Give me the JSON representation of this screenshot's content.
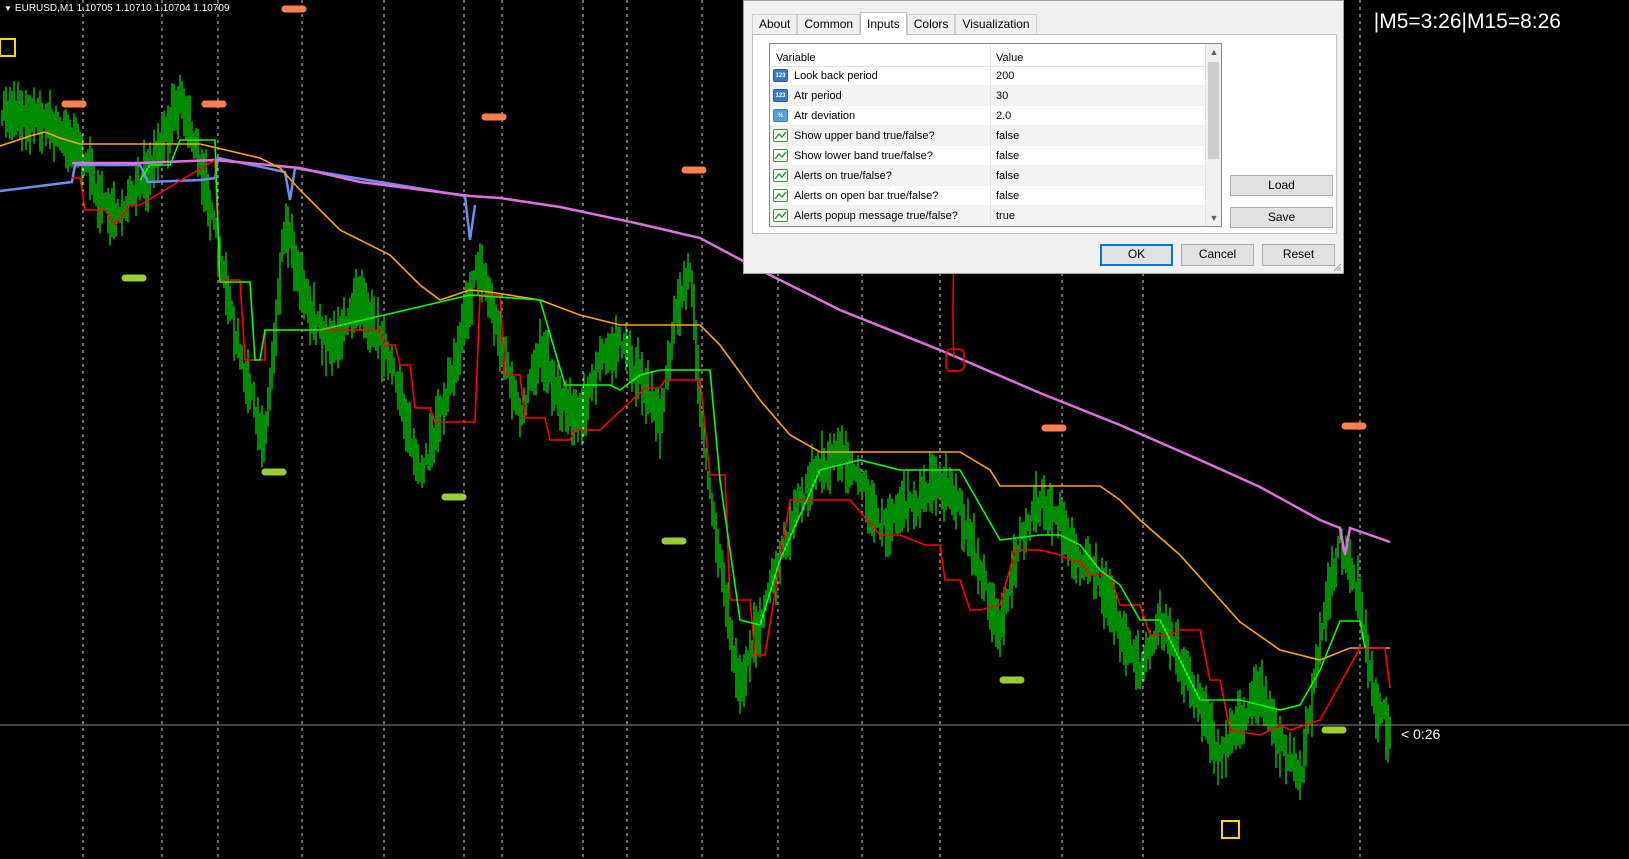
{
  "chart": {
    "symbol_info": "EURUSD,M1  1.10705 1.10710 1.10704 1.10709",
    "timer_text": "|M5=3:26|M15=8:26",
    "price_marker": "< 0:26"
  },
  "colors": {
    "background": "#000000",
    "candles": "#00ff00",
    "ma_magenta": "#e070e0",
    "ma_orange": "#ffa500",
    "step_red": "#ff0000",
    "step_green": "#00ff00",
    "upper_dash": "#ff7f50",
    "lower_dash": "#9acd32",
    "annotation": "#ff0000",
    "box_marker": "#ffd700"
  },
  "dialog": {
    "tabs": [
      {
        "label": "About",
        "active": false
      },
      {
        "label": "Common",
        "active": false
      },
      {
        "label": "Inputs",
        "active": true
      },
      {
        "label": "Colors",
        "active": false
      },
      {
        "label": "Visualization",
        "active": false
      }
    ],
    "columns": {
      "variable": "Variable",
      "value": "Value"
    },
    "rows": [
      {
        "icon": "integer-type-icon",
        "icon_text": "123",
        "variable": "Look back period",
        "value": "200"
      },
      {
        "icon": "integer-type-icon",
        "icon_text": "123",
        "variable": "Atr period",
        "value": "30"
      },
      {
        "icon": "double-type-icon",
        "icon_text": "½",
        "variable": "Atr deviation",
        "value": "2.0"
      },
      {
        "icon": "bool-type-icon",
        "icon_text": "",
        "variable": "Show upper band true/false?",
        "value": "false"
      },
      {
        "icon": "bool-type-icon",
        "icon_text": "",
        "variable": "Show lower band true/false?",
        "value": "false"
      },
      {
        "icon": "bool-type-icon",
        "icon_text": "",
        "variable": "Alerts on true/false?",
        "value": "false"
      },
      {
        "icon": "bool-type-icon",
        "icon_text": "",
        "variable": "Alerts on open bar true/false?",
        "value": "false"
      },
      {
        "icon": "bool-type-icon",
        "icon_text": "",
        "variable": "Alerts popup message true/false?",
        "value": "true"
      }
    ],
    "buttons": {
      "load": "Load",
      "save": "Save",
      "ok": "OK",
      "cancel": "Cancel",
      "reset": "Reset"
    }
  }
}
